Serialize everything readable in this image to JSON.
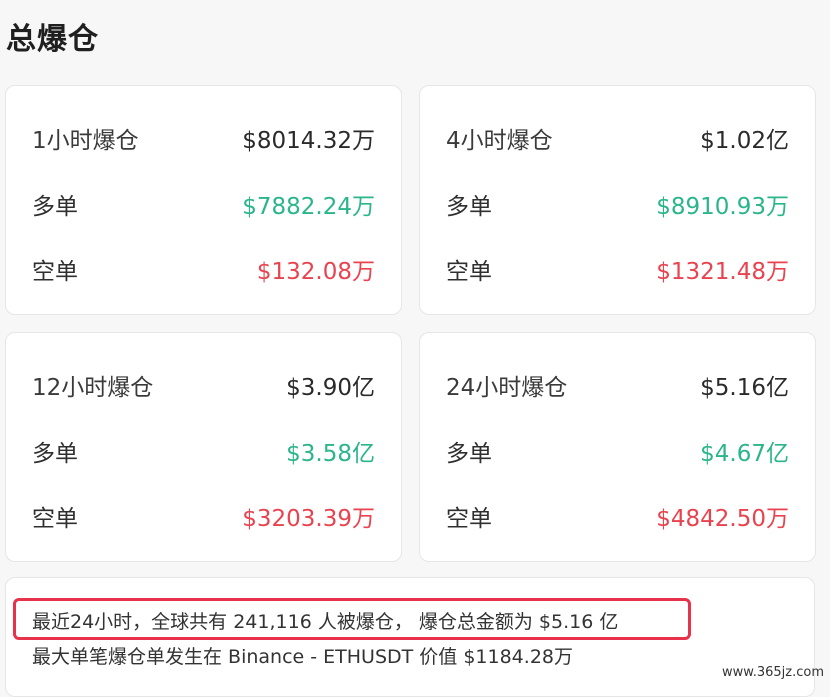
{
  "page": {
    "title": "总爆仓"
  },
  "cards": [
    {
      "period": "1小时爆仓",
      "total": "$8014.32万",
      "long_label": "多单",
      "long": "$7882.24万",
      "short_label": "空单",
      "short": "$132.08万"
    },
    {
      "period": "4小时爆仓",
      "total": "$1.02亿",
      "long_label": "多单",
      "long": "$8910.93万",
      "short_label": "空单",
      "short": "$1321.48万"
    },
    {
      "period": "12小时爆仓",
      "total": "$3.90亿",
      "long_label": "多单",
      "long": "$3.58亿",
      "short_label": "空单",
      "short": "$3203.39万"
    },
    {
      "period": "24小时爆仓",
      "total": "$5.16亿",
      "long_label": "多单",
      "long": "$4.67亿",
      "short_label": "空单",
      "short": "$4842.50万"
    }
  ],
  "summary": {
    "line1": "最近24小时，全球共有 241,116 人被爆仓， 爆仓总金额为 $5.16 亿",
    "line2": "最大单笔爆仓单发生在 Binance - ETHUSDT 价值 $1184.28万"
  },
  "watermark": "www.365jz.com",
  "colors": {
    "long": "#2bb58b",
    "short": "#e8434f",
    "highlight_border": "#e8314a"
  }
}
